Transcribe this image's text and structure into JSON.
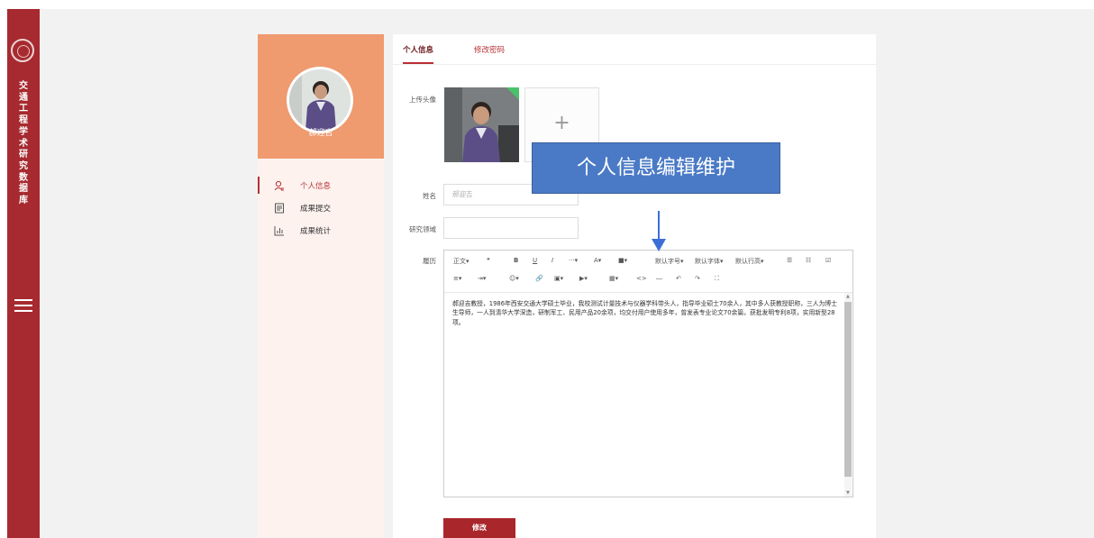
{
  "sidebar": {
    "title": "交通工程学术研究数据库"
  },
  "profile": {
    "name": "郝迎吉"
  },
  "menu": {
    "items": [
      {
        "label": "个人信息",
        "icon": "user-icon"
      },
      {
        "label": "成果提交",
        "icon": "document-icon"
      },
      {
        "label": "成果统计",
        "icon": "bar-chart-icon"
      }
    ]
  },
  "tabs": [
    {
      "label": "个人信息"
    },
    {
      "label": "修改密码"
    }
  ],
  "form": {
    "avatar_label": "上传头像",
    "add_symbol": "+",
    "name_label": "姓名",
    "name_placeholder": "郝迎吉",
    "field_label": "研究领域",
    "field_value": "",
    "bio_label": "履历",
    "bio_text": "郝迎吉教授，1986年西安交通大学硕士毕业，我校测试计量技术与仪器学科带头人，指导毕业硕士70余人，其中多人获教授职称，三人为博士生导师，一人到清华大学深造，研制军工、民用产品20余项，均交付用户使用多年，曾发表专业论文70余篇，获批发明专利8项，实用新型28项。",
    "save_label": "修改"
  },
  "toolbar": {
    "paragraph": "正文▾",
    "quote": "❝",
    "bold": "B",
    "underline": "U",
    "italic": "I",
    "more": "···▾",
    "font_color": "A▾",
    "bg_color": "■▾",
    "font_size": "默认字号▾",
    "font_family": "默认字体▾",
    "line_height": "默认行高▾",
    "bullet_list": "☰",
    "numbered_list": "☷",
    "todo": "☑",
    "align": "≡▾",
    "indent": "⇥▾",
    "emoji": "☺▾",
    "link": "🔗",
    "image": "▣▾",
    "video": "▶▾",
    "table": "▦▾",
    "code": "<>",
    "divider": "―",
    "undo": "↶",
    "redo": "↷",
    "fullscreen": "⛶"
  },
  "callout": {
    "text": "个人信息编辑维护"
  },
  "colors": {
    "brand": "#a62a2f",
    "header_orange": "#ef9a6f",
    "callout_blue": "#4a7ac6"
  }
}
